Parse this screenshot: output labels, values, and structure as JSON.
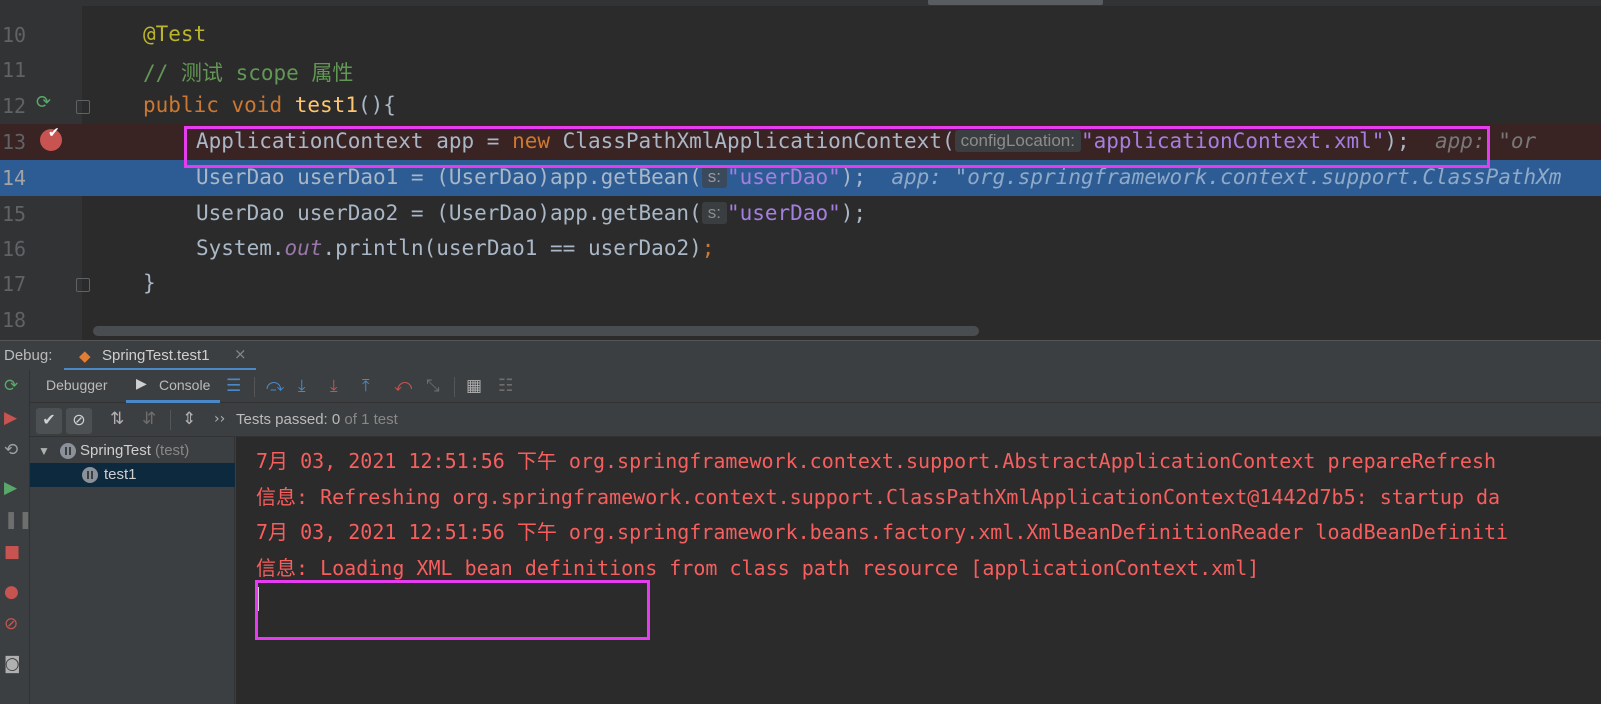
{
  "editor": {
    "lines": [
      {
        "num": "10",
        "annotation": "@Test"
      },
      {
        "num": "11",
        "comment": "// 测试 scope 属性"
      },
      {
        "num": "12",
        "kw1": "public",
        "kw2": "void",
        "method": "test1",
        "rest": "(){"
      },
      {
        "num": "13",
        "type": "ApplicationContext app = ",
        "kw": "new",
        "call": " ClassPathXmlApplicationContext(",
        "hint": "configLocation:",
        "str": "\"applicationContext.xml\"",
        "end": ");",
        "inline": "app: \"or"
      },
      {
        "num": "14",
        "pre": "UserDao userDao1 = (UserDao)app.getBean(",
        "hint": "s:",
        "str": "\"userDao\"",
        "end": ");",
        "inline": "app: \"org.springframework.context.support.ClassPathXm"
      },
      {
        "num": "15",
        "pre": "UserDao userDao2 = (UserDao)app.getBean(",
        "hint": "s:",
        "str": "\"userDao\"",
        "end": ");"
      },
      {
        "num": "16",
        "pre": "System.",
        "field": "out",
        "post": ".println(userDao1 == userDao2)",
        "end": ";"
      },
      {
        "num": "17",
        "brace": "}"
      },
      {
        "num": "18"
      }
    ]
  },
  "debug": {
    "label": "Debug:",
    "tab_title": "SpringTest.test1",
    "tabs": {
      "debugger": "Debugger",
      "console": "Console"
    },
    "tests_status": {
      "prefix": "Tests passed:",
      "count": "0",
      "suffix": "of 1 test"
    },
    "more": "››",
    "tree": [
      {
        "name": "SpringTest",
        "sub": "(test)"
      },
      {
        "name": "test1"
      }
    ],
    "console_lines": [
      "7月 03, 2021 12:51:56 下午 org.springframework.context.support.AbstractApplicationContext prepareRefresh",
      "信息: Refreshing org.springframework.context.support.ClassPathXmlApplicationContext@1442d7b5: startup da",
      "7月 03, 2021 12:51:56 下午 org.springframework.beans.factory.xml.XmlBeanDefinitionReader loadBeanDefiniti",
      "信息: Loading XML bean definitions from class path resource [applicationContext.xml]"
    ]
  },
  "colors": {
    "accent": "#4a88c7",
    "highlight": "#e53cf0",
    "error_text": "#f75e5e",
    "current_line": "#2d5c94"
  }
}
